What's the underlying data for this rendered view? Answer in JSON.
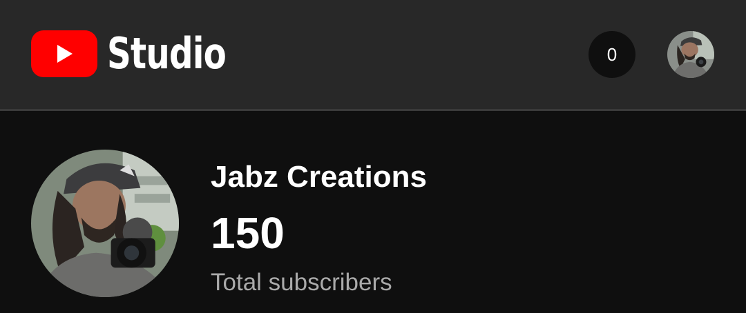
{
  "header": {
    "logo_text": "Studio",
    "logo_icon": "youtube-play-icon",
    "notification_count": "0",
    "avatar_icon": "profile-photo"
  },
  "channel": {
    "name": "Jabz Creations",
    "subscriber_count": "150",
    "subscriber_label": "Total subscribers",
    "avatar_icon": "channel-photo"
  },
  "colors": {
    "header_bg": "#282828",
    "page_bg": "#0f0f0f",
    "brand_red": "#ff0000",
    "text_primary": "#ffffff",
    "text_secondary": "#aaaaaa"
  }
}
